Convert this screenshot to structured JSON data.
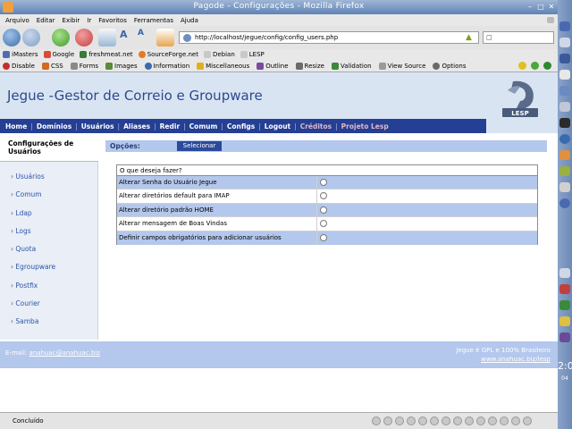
{
  "window": {
    "title": "Pagode - Configurações - Mozilla Firefox"
  },
  "menu": [
    "Arquivo",
    "Editar",
    "Exibir",
    "Ir",
    "Favoritos",
    "Ferramentas",
    "Ajuda"
  ],
  "address": {
    "url": "http://localhost/jegue/config/config_users.php"
  },
  "bookmarks": [
    "iMasters",
    "Google",
    "freshmeat.net",
    "SourceForge.net",
    "Debian",
    "LESP"
  ],
  "devtools": [
    "Disable",
    "CSS",
    "Forms",
    "Images",
    "Information",
    "Miscellaneous",
    "Outline",
    "Resize",
    "Validation",
    "View Source",
    "Options"
  ],
  "page": {
    "app_title": "Jegue -Gestor de Correio e Groupware",
    "logo_text": "LESP",
    "nav": [
      "Home",
      "Domínios",
      "Usuários",
      "Aliases",
      "Redir",
      "Comum",
      "Configs",
      "Logout"
    ],
    "nav_extra": [
      "Créditos",
      "Projeto Lesp"
    ],
    "sidebar": {
      "heading": "Configurações de Usuários",
      "items": [
        "Usuários",
        "Comum",
        "Ldap",
        "Logs",
        "Quota",
        "Egroupware",
        "Postfix",
        "Courier",
        "Samba"
      ]
    },
    "options": {
      "label": "Opções:",
      "select_label": "Selecionar"
    },
    "question": "O que deseja fazer?",
    "choices": [
      "Alterar Senha do Usuário Jegue",
      "Alterar diretórios default para IMAP",
      "Alterar diretório padrão HOME",
      "Alterar mensagem de Boas Vindas",
      "Definir campos obrigatórios para adicionar usuários"
    ],
    "footer": {
      "email_label": "E-mail:",
      "email": "anahuac@anahuac.biz",
      "license": "Jegue é GPL e 100% Brasileiro",
      "site": "www.anahuac.biz/lesp"
    }
  },
  "status": {
    "text": "Concluído"
  },
  "panel": {
    "clock": "2:0",
    "date": "04"
  },
  "colors": {
    "nav_bg": "#243f93",
    "banner_bg": "#d9e4f3",
    "accent_light": "#b4c7ec"
  }
}
